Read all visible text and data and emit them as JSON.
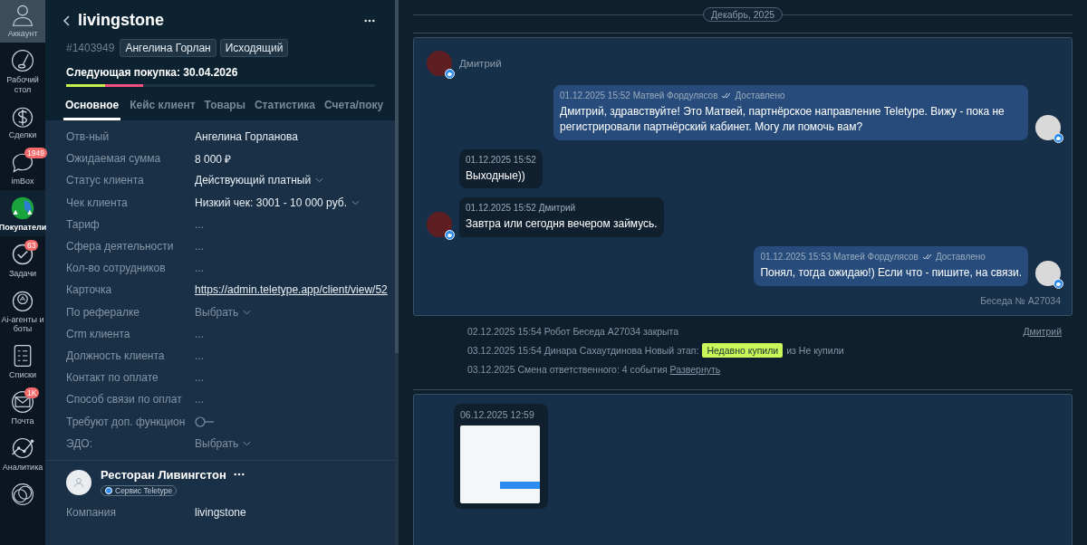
{
  "nav": [
    {
      "label": "Аккаунт",
      "selected": false
    },
    {
      "label": "Рабочий стол",
      "selected": false
    },
    {
      "label": "Сделки",
      "selected": false
    },
    {
      "label": "imBox",
      "selected": false,
      "badge": "1949"
    },
    {
      "label": "Покупатели",
      "selected": true
    },
    {
      "label": "Задачи",
      "selected": false,
      "badge": "63"
    },
    {
      "label": "Ai-агенты и боты",
      "selected": false
    },
    {
      "label": "Списки",
      "selected": false
    },
    {
      "label": "Почта",
      "selected": false,
      "badge": "1K"
    },
    {
      "label": "Аналитика",
      "selected": false
    },
    {
      "selected": false
    }
  ],
  "card": {
    "title": "livingstone",
    "id": "#1403949",
    "tags": [
      "Ангелина Горлан",
      "Исходящий"
    ],
    "next_purchase": "Следующая покупка: 30.04.2026",
    "progress": [
      {
        "color": "#c6f04e",
        "level": 0.125
      },
      {
        "color": "#f2507f",
        "level": 0.125
      }
    ],
    "tabs": [
      {
        "label": "Основное",
        "selected": true
      },
      {
        "label": "Кейс клиент",
        "selected": false
      },
      {
        "label": "Товары",
        "selected": false
      },
      {
        "label": "Статистика",
        "selected": false
      },
      {
        "label": "Счета/поку",
        "selected": false
      }
    ],
    "fields": [
      {
        "label": "Отв-ный",
        "kind": "text",
        "value": "Ангелина Горланова"
      },
      {
        "label": "Ожидаемая сумма",
        "kind": "text",
        "value": "8 000 ₽"
      },
      {
        "label": "Статус клиента",
        "kind": "select",
        "value": "Действующий платный"
      },
      {
        "label": "Чек клиента",
        "kind": "select",
        "value": "Низкий чек: 3001 - 10 000 руб."
      },
      {
        "label": "Тариф",
        "kind": "empty",
        "value": "..."
      },
      {
        "label": "Сфера деятельности",
        "kind": "empty",
        "value": "..."
      },
      {
        "label": "Кол-во сотрудников",
        "kind": "empty",
        "value": "..."
      },
      {
        "label": "Карточка",
        "kind": "link",
        "value": "https://admin.teletype.app/client/view/52"
      },
      {
        "label": "По рефералке",
        "kind": "placeholder",
        "value": "Выбрать"
      },
      {
        "label": "Crm клиента",
        "kind": "empty",
        "value": "..."
      },
      {
        "label": "Должность клиента",
        "kind": "empty",
        "value": "..."
      },
      {
        "label": "Контакт по оплате",
        "kind": "empty",
        "value": "..."
      },
      {
        "label": "Способ связи по оплат",
        "kind": "empty",
        "value": "..."
      },
      {
        "label": "Требуют доп. функцион",
        "kind": "toggle",
        "on": false
      },
      {
        "label": "ЭДО:",
        "kind": "placeholder",
        "value": "Выбрать"
      }
    ],
    "company": {
      "name": "Ресторан Ливингстон",
      "badge": "Сервис Teletype",
      "fields": [
        {
          "label": "Компания",
          "value": "livingstone"
        }
      ]
    }
  },
  "feed": {
    "month": "Декабрь, 2025",
    "conversation": {
      "contact": "Дмитрий",
      "number": "Беседа № A27034",
      "messages": [
        {
          "kind": "outgoing",
          "meta": "01.12.2025 15:52 Матвей Фордулясов",
          "status": "Доставлено",
          "text": "Дмитрий, здравствуйте! Это Матвей, партнёрское направление Teletype. Вижу - пока не регистрировали партнёрский кабинет. Могу ли помочь вам?"
        },
        {
          "kind": "incoming",
          "meta": "01.12.2025 15:52",
          "text": "Выходные))",
          "avatar": false
        },
        {
          "kind": "incoming",
          "meta": "01.12.2025 15:52 Дмитрий",
          "text": "Завтра или сегодня вечером займусь.",
          "avatar": true
        },
        {
          "kind": "outgoing",
          "meta": "01.12.2025 15:53 Матвей Фордулясов",
          "status": "Доставлено",
          "text": "Понял, тогда ожидаю!) Если что - пишите, на связи."
        }
      ]
    },
    "events": [
      {
        "text": "02.12.2025 15:54 Робот Беседа A27034 закрыта",
        "right_link": "Дмитрий"
      },
      {
        "text": "03.12.2025 15:54 Динара Сахаутдинова Новый этап:",
        "tag": "Недавно купили",
        "suffix": "из Не купили"
      },
      {
        "text": "03.12.2025 Смена ответственного: 4 события",
        "link": "Развернуть"
      }
    ],
    "attachment_message": {
      "meta": "06.12.2025 12:59"
    }
  }
}
